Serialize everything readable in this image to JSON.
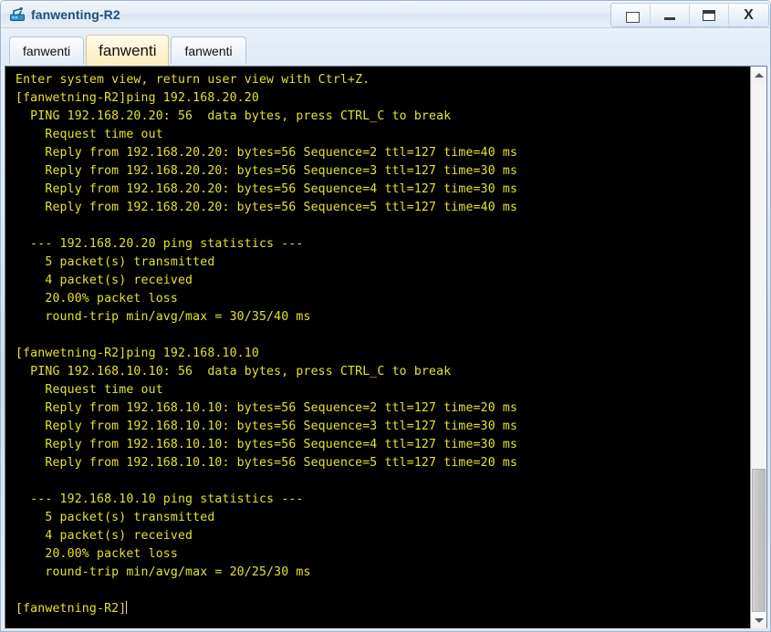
{
  "window": {
    "title": "fanwenting-R2",
    "icon": "router-icon",
    "controls": [
      {
        "name": "restore-window-button",
        "icon": "restore-icon",
        "label": ""
      },
      {
        "name": "minimize-window-button",
        "icon": "minimize-icon",
        "label": ""
      },
      {
        "name": "maximize-window-button",
        "icon": "maximize-icon",
        "label": ""
      },
      {
        "name": "close-window-button",
        "icon": "close-icon",
        "label": "X"
      }
    ]
  },
  "tabs": [
    {
      "label": "fanwenti",
      "active": false
    },
    {
      "label": "fanwenti",
      "active": true
    },
    {
      "label": "fanwenti",
      "active": false
    }
  ],
  "terminal": {
    "foreground": "#e2e22e",
    "background": "#000000",
    "prompt": "[fanwetning-R2]",
    "lines": [
      "Enter system view, return user view with Ctrl+Z.",
      "[fanwetning-R2]ping 192.168.20.20",
      "  PING 192.168.20.20: 56  data bytes, press CTRL_C to break",
      "    Request time out",
      "    Reply from 192.168.20.20: bytes=56 Sequence=2 ttl=127 time=40 ms",
      "    Reply from 192.168.20.20: bytes=56 Sequence=3 ttl=127 time=30 ms",
      "    Reply from 192.168.20.20: bytes=56 Sequence=4 ttl=127 time=30 ms",
      "    Reply from 192.168.20.20: bytes=56 Sequence=5 ttl=127 time=40 ms",
      "",
      "  --- 192.168.20.20 ping statistics ---",
      "    5 packet(s) transmitted",
      "    4 packet(s) received",
      "    20.00% packet loss",
      "    round-trip min/avg/max = 30/35/40 ms",
      "",
      "[fanwetning-R2]ping 192.168.10.10",
      "  PING 192.168.10.10: 56  data bytes, press CTRL_C to break",
      "    Request time out",
      "    Reply from 192.168.10.10: bytes=56 Sequence=2 ttl=127 time=20 ms",
      "    Reply from 192.168.10.10: bytes=56 Sequence=3 ttl=127 time=30 ms",
      "    Reply from 192.168.10.10: bytes=56 Sequence=4 ttl=127 time=30 ms",
      "    Reply from 192.168.10.10: bytes=56 Sequence=5 ttl=127 time=20 ms",
      "",
      "  --- 192.168.10.10 ping statistics ---",
      "    5 packet(s) transmitted",
      "    4 packet(s) received",
      "    20.00% packet loss",
      "    round-trip min/avg/max = 20/25/30 ms",
      "",
      "[fanwetning-R2]"
    ]
  },
  "scrollbar": {
    "up_icon": "chevron-up-icon",
    "down_icon": "chevron-down-icon",
    "thumb_top_pct": 73,
    "thumb_height_pct": 27
  }
}
